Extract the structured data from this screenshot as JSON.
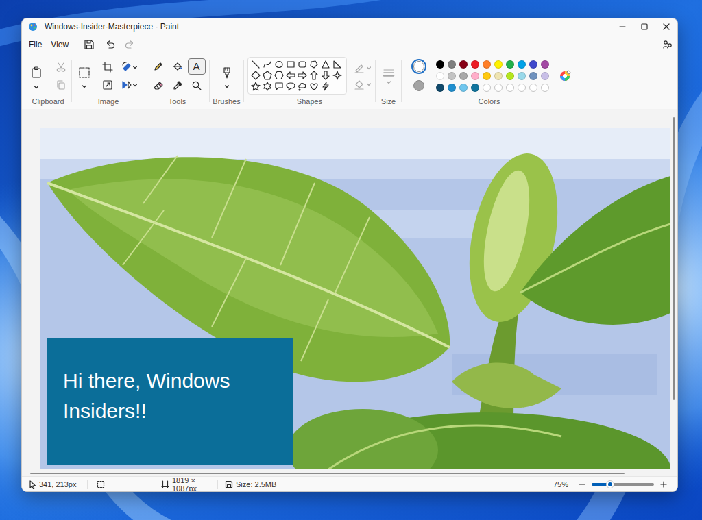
{
  "window": {
    "title": "Windows-Insider-Masterpiece - Paint"
  },
  "menu": [
    {
      "label": "File"
    },
    {
      "label": "View"
    }
  ],
  "toolbar": {
    "undo_disabled": false,
    "redo_disabled": true
  },
  "ribbon": {
    "clipboard": {
      "label": "Clipboard",
      "cut_disabled": true,
      "copy_disabled": true
    },
    "image": {
      "label": "Image"
    },
    "tools": {
      "label": "Tools",
      "items": [
        {
          "kind": "pencil",
          "selected": false
        },
        {
          "kind": "fill",
          "selected": false
        },
        {
          "kind": "text",
          "glyph": "A",
          "selected": true
        },
        {
          "kind": "eraser",
          "selected": false
        },
        {
          "kind": "picker",
          "selected": false
        },
        {
          "kind": "magnifier",
          "selected": false
        }
      ]
    },
    "brushes": {
      "label": "Brushes"
    },
    "shapes": {
      "label": "Shapes",
      "outline_disabled": true,
      "fill_disabled": true
    },
    "size": {
      "label": "Size",
      "disabled": true
    },
    "colors": {
      "label": "Colors",
      "current": [
        {
          "color": "#ffffff",
          "selected": true
        },
        {
          "color": "#a3a3a3",
          "selected": false
        }
      ],
      "swatches": [
        {
          "kind": "filled",
          "color": "#000000"
        },
        {
          "kind": "filled",
          "color": "#7f7f7f"
        },
        {
          "kind": "filled",
          "color": "#880015"
        },
        {
          "kind": "filled",
          "color": "#ed1c24"
        },
        {
          "kind": "filled",
          "color": "#ff7f27"
        },
        {
          "kind": "filled",
          "color": "#fff200"
        },
        {
          "kind": "filled",
          "color": "#22b14c"
        },
        {
          "kind": "filled",
          "color": "#00a2e8"
        },
        {
          "kind": "filled",
          "color": "#3f48cc"
        },
        {
          "kind": "filled",
          "color": "#a349a4"
        },
        {
          "kind": "filled",
          "color": "#ffffff"
        },
        {
          "kind": "filled",
          "color": "#c3c3c3"
        },
        {
          "kind": "filled",
          "color": "#a8a8a8"
        },
        {
          "kind": "filled",
          "color": "#ffaec9"
        },
        {
          "kind": "filled",
          "color": "#ffc90e"
        },
        {
          "kind": "filled",
          "color": "#efe4b0"
        },
        {
          "kind": "filled",
          "color": "#b5e61d"
        },
        {
          "kind": "filled",
          "color": "#99d9ea"
        },
        {
          "kind": "filled",
          "color": "#7092be"
        },
        {
          "kind": "filled",
          "color": "#c8bfe7"
        },
        {
          "kind": "filled",
          "color": "#10496b"
        },
        {
          "kind": "filled",
          "color": "#1f8fcf"
        },
        {
          "kind": "filled",
          "color": "#6fc6ee"
        },
        {
          "kind": "filled",
          "color": "#11759e"
        },
        {
          "kind": "empty"
        },
        {
          "kind": "empty"
        },
        {
          "kind": "empty"
        },
        {
          "kind": "empty"
        },
        {
          "kind": "empty"
        },
        {
          "kind": "empty"
        }
      ]
    }
  },
  "canvas": {
    "text": "Hi there, Windows Insiders!!",
    "scroll_horizontal_level": 0.93,
    "scroll_vertical_level": 0.82
  },
  "status_bar": {
    "position": "341, 213px",
    "canvas_size": "1819 × 1087px",
    "file_size": "Size: 2.5MB",
    "zoom": "75%",
    "zoom_level": 0.3
  }
}
